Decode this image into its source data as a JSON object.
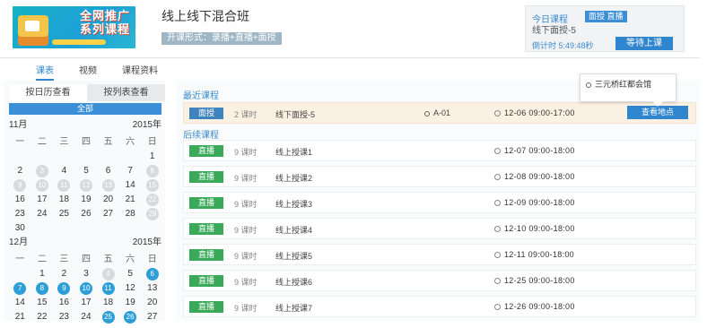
{
  "header": {
    "thumbnail_text": "全网推广\n系列课程",
    "title": "线上线下混合班",
    "mode_tag": "开课形式：录播+直播+面授"
  },
  "today": {
    "label": "今日课程",
    "badge": "面授 直播",
    "course_name": "线下面授-5",
    "countdown": "倒计时 5:49:48秒",
    "wait_button": "等待上课"
  },
  "tabs": [
    {
      "label": "课表",
      "active": true
    },
    {
      "label": "视频",
      "active": false
    },
    {
      "label": "课程资料",
      "active": false
    }
  ],
  "calendar": {
    "switch": [
      {
        "label": "按日历查看",
        "active": true
      },
      {
        "label": "按列表查看",
        "active": false
      }
    ],
    "all_label": "全部",
    "weekdays": [
      "一",
      "二",
      "三",
      "四",
      "五",
      "六",
      "日"
    ],
    "months": [
      {
        "month": "11月",
        "year": "2015年",
        "offset": 6,
        "days": [
          {
            "d": "1",
            "s": ""
          },
          {
            "d": "2",
            "s": ""
          },
          {
            "d": "3",
            "s": "past"
          },
          {
            "d": "4",
            "s": ""
          },
          {
            "d": "5",
            "s": ""
          },
          {
            "d": "6",
            "s": ""
          },
          {
            "d": "7",
            "s": ""
          },
          {
            "d": "8",
            "s": "past"
          },
          {
            "d": "9",
            "s": "past"
          },
          {
            "d": "10",
            "s": "past"
          },
          {
            "d": "11",
            "s": "past"
          },
          {
            "d": "12",
            "s": "past"
          },
          {
            "d": "13",
            "s": "past"
          },
          {
            "d": "14",
            "s": ""
          },
          {
            "d": "15",
            "s": "past"
          },
          {
            "d": "16",
            "s": ""
          },
          {
            "d": "17",
            "s": ""
          },
          {
            "d": "18",
            "s": ""
          },
          {
            "d": "19",
            "s": ""
          },
          {
            "d": "20",
            "s": ""
          },
          {
            "d": "21",
            "s": ""
          },
          {
            "d": "22",
            "s": "past"
          },
          {
            "d": "23",
            "s": ""
          },
          {
            "d": "24",
            "s": ""
          },
          {
            "d": "25",
            "s": ""
          },
          {
            "d": "26",
            "s": ""
          },
          {
            "d": "27",
            "s": ""
          },
          {
            "d": "28",
            "s": ""
          },
          {
            "d": "29",
            "s": "past"
          },
          {
            "d": "30",
            "s": ""
          }
        ]
      },
      {
        "month": "12月",
        "year": "2015年",
        "offset": 1,
        "days": [
          {
            "d": "1",
            "s": ""
          },
          {
            "d": "2",
            "s": ""
          },
          {
            "d": "3",
            "s": ""
          },
          {
            "d": "4",
            "s": "past"
          },
          {
            "d": "5",
            "s": ""
          },
          {
            "d": "6",
            "s": "hl"
          },
          {
            "d": "7",
            "s": "hl"
          },
          {
            "d": "8",
            "s": "hl"
          },
          {
            "d": "9",
            "s": "hl"
          },
          {
            "d": "10",
            "s": "hl"
          },
          {
            "d": "11",
            "s": "hl"
          },
          {
            "d": "12",
            "s": ""
          },
          {
            "d": "13",
            "s": ""
          },
          {
            "d": "14",
            "s": ""
          },
          {
            "d": "15",
            "s": ""
          },
          {
            "d": "16",
            "s": ""
          },
          {
            "d": "17",
            "s": ""
          },
          {
            "d": "18",
            "s": ""
          },
          {
            "d": "19",
            "s": ""
          },
          {
            "d": "20",
            "s": ""
          },
          {
            "d": "21",
            "s": ""
          },
          {
            "d": "22",
            "s": ""
          },
          {
            "d": "23",
            "s": ""
          },
          {
            "d": "24",
            "s": ""
          },
          {
            "d": "25",
            "s": "hl"
          },
          {
            "d": "26",
            "s": "hl"
          },
          {
            "d": "27",
            "s": ""
          }
        ]
      }
    ]
  },
  "schedule": {
    "recent_title": "最近课程",
    "later_title": "后续课程",
    "current": {
      "type": "面授",
      "hours": "2 课时",
      "name": "线下面授-5",
      "location": "A-01",
      "time": "12-06  09:00-17:00",
      "button": "查看地点"
    },
    "upcoming": [
      {
        "type": "直播",
        "hours": "9 课时",
        "name": "线上授课1",
        "time": "12-07  09:00-18:00"
      },
      {
        "type": "直播",
        "hours": "9 课时",
        "name": "线上授课2",
        "time": "12-08  09:00-18:00"
      },
      {
        "type": "直播",
        "hours": "9 课时",
        "name": "线上授课3",
        "time": "12-09  09:00-18:00"
      },
      {
        "type": "直播",
        "hours": "9 课时",
        "name": "线上授课4",
        "time": "12-10  09:00-18:00"
      },
      {
        "type": "直播",
        "hours": "9 课时",
        "name": "线上授课5",
        "time": "12-11  09:00-18:00"
      },
      {
        "type": "直播",
        "hours": "9 课时",
        "name": "线上授课6",
        "time": "12-25  09:00-18:00"
      },
      {
        "type": "直播",
        "hours": "9 课时",
        "name": "线上授课7",
        "time": "12-26  09:00-18:00"
      }
    ]
  },
  "popover": {
    "address": "三元桥红都会馆"
  },
  "colors": {
    "accent": "#2f86cf",
    "live": "#3aa95a",
    "face": "#3f84bf",
    "current_row": "#fbf1e3",
    "calendar_highlight": "#2c9fd9"
  }
}
